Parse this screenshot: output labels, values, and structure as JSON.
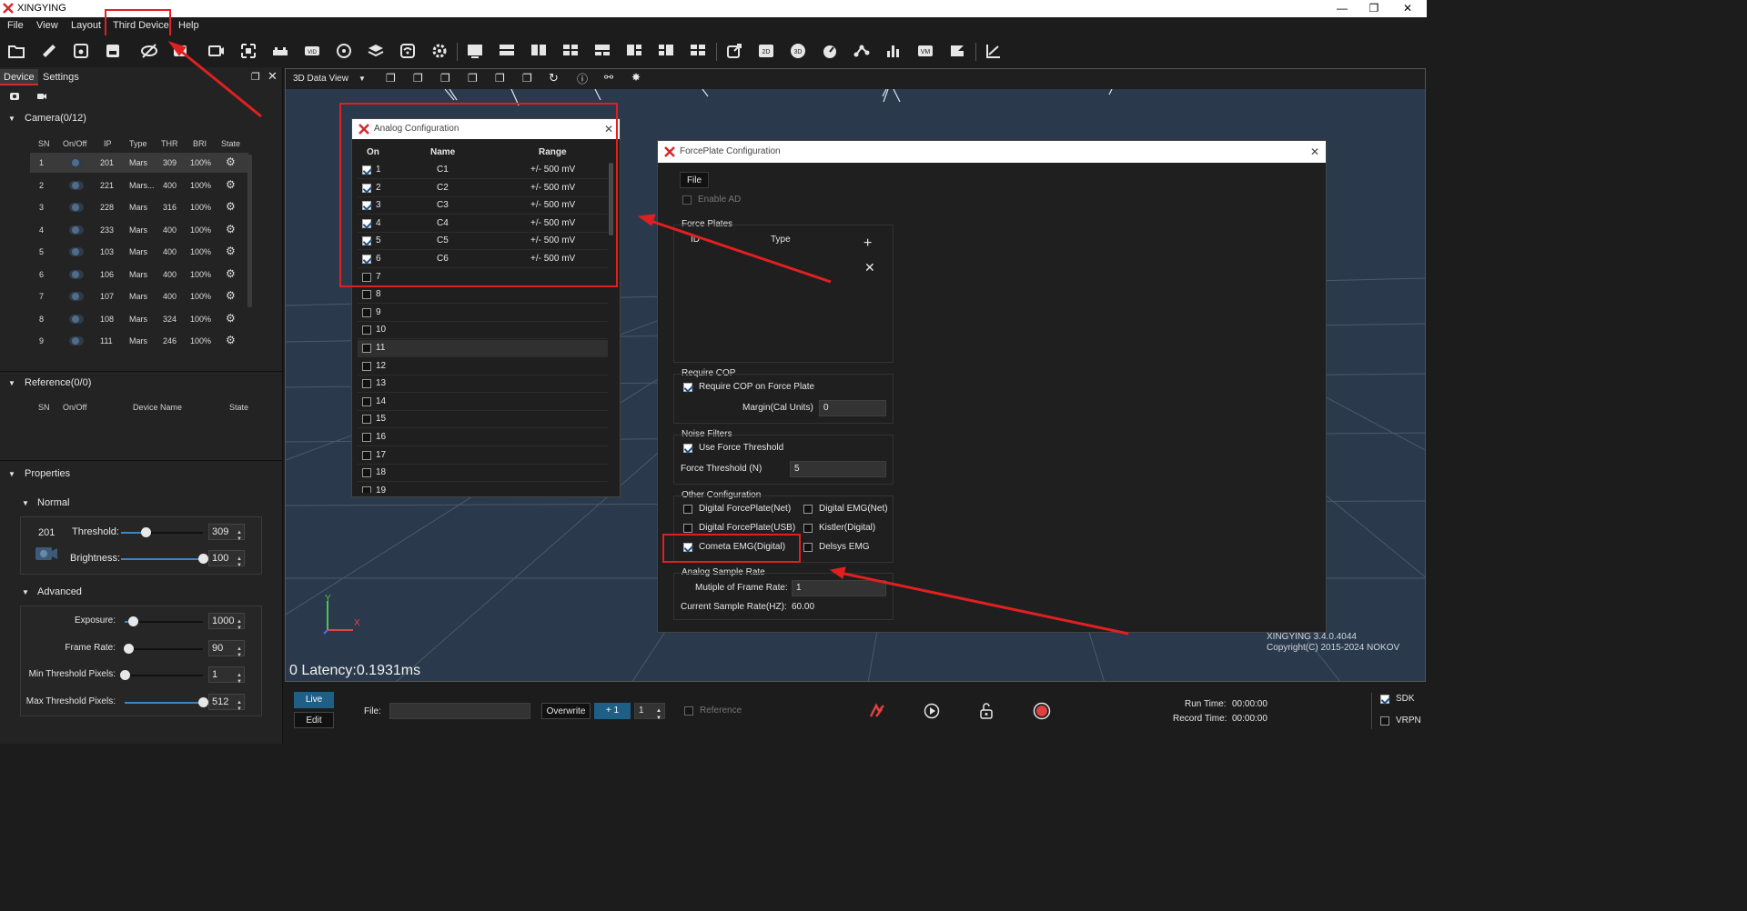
{
  "app": {
    "title": "XINGYING"
  },
  "menu": [
    "File",
    "View",
    "Layout",
    "Third Device",
    "Help"
  ],
  "left_panel": {
    "tabs": [
      "Device",
      "Settings"
    ],
    "camera": {
      "header": "Camera(0/12)",
      "columns": [
        "SN",
        "On/Off",
        "IP",
        "Type",
        "THR",
        "BRI",
        "State"
      ],
      "rows": [
        {
          "sn": "1",
          "ip": "201",
          "type": "Mars",
          "thr": "309",
          "bri": "100%"
        },
        {
          "sn": "2",
          "ip": "221",
          "type": "Mars...",
          "thr": "400",
          "bri": "100%"
        },
        {
          "sn": "3",
          "ip": "228",
          "type": "Mars",
          "thr": "316",
          "bri": "100%"
        },
        {
          "sn": "4",
          "ip": "233",
          "type": "Mars",
          "thr": "400",
          "bri": "100%"
        },
        {
          "sn": "5",
          "ip": "103",
          "type": "Mars",
          "thr": "400",
          "bri": "100%"
        },
        {
          "sn": "6",
          "ip": "106",
          "type": "Mars",
          "thr": "400",
          "bri": "100%"
        },
        {
          "sn": "7",
          "ip": "107",
          "type": "Mars",
          "thr": "400",
          "bri": "100%"
        },
        {
          "sn": "8",
          "ip": "108",
          "type": "Mars",
          "thr": "324",
          "bri": "100%"
        },
        {
          "sn": "9",
          "ip": "111",
          "type": "Mars",
          "thr": "246",
          "bri": "100%"
        }
      ]
    },
    "reference": {
      "header": "Reference(0/0)",
      "columns": [
        "SN",
        "On/Off",
        "Device Name",
        "State"
      ]
    },
    "properties": {
      "header": "Properties",
      "normal": {
        "header": "Normal",
        "camera_id": "201",
        "threshold_label": "Threshold:",
        "threshold": "309",
        "threshold_frac": 0.3,
        "brightness_label": "Brightness:",
        "brightness": "100",
        "brightness_frac": 1.0
      },
      "advanced": {
        "header": "Advanced",
        "items": [
          {
            "label": "Exposure:",
            "value": "1000",
            "frac": 0.1
          },
          {
            "label": "Frame Rate:",
            "value": "90",
            "frac": 0.05
          },
          {
            "label": "Min Threshold Pixels:",
            "value": "1",
            "frac": 0.0
          },
          {
            "label": "Max Threshold Pixels:",
            "value": "512",
            "frac": 1.0
          }
        ]
      }
    }
  },
  "viewport": {
    "view_select": "3D Data View",
    "latency": "0 Latency:0.1931ms",
    "axis_y": "Y",
    "axis_x": "X",
    "version": "XINGYING 3.4.0.4044",
    "copyright": "Copyright(C) 2015-2024 NOKOV"
  },
  "analog_dialog": {
    "title": "Analog Configuration",
    "columns": [
      "On",
      "Name",
      "Range"
    ],
    "rows": [
      {
        "num": "1",
        "checked": true,
        "name": "C1",
        "range": "+/- 500 mV"
      },
      {
        "num": "2",
        "checked": true,
        "name": "C2",
        "range": "+/- 500 mV"
      },
      {
        "num": "3",
        "checked": true,
        "name": "C3",
        "range": "+/- 500 mV"
      },
      {
        "num": "4",
        "checked": true,
        "name": "C4",
        "range": "+/- 500 mV"
      },
      {
        "num": "5",
        "checked": true,
        "name": "C5",
        "range": "+/- 500 mV"
      },
      {
        "num": "6",
        "checked": true,
        "name": "C6",
        "range": "+/- 500 mV"
      },
      {
        "num": "7",
        "checked": false,
        "name": "",
        "range": ""
      },
      {
        "num": "8",
        "checked": false,
        "name": "",
        "range": ""
      },
      {
        "num": "9",
        "checked": false,
        "name": "",
        "range": ""
      },
      {
        "num": "10",
        "checked": false,
        "name": "",
        "range": ""
      },
      {
        "num": "11",
        "checked": false,
        "name": "",
        "range": ""
      },
      {
        "num": "12",
        "checked": false,
        "name": "",
        "range": ""
      },
      {
        "num": "13",
        "checked": false,
        "name": "",
        "range": ""
      },
      {
        "num": "14",
        "checked": false,
        "name": "",
        "range": ""
      },
      {
        "num": "15",
        "checked": false,
        "name": "",
        "range": ""
      },
      {
        "num": "16",
        "checked": false,
        "name": "",
        "range": ""
      },
      {
        "num": "17",
        "checked": false,
        "name": "",
        "range": ""
      },
      {
        "num": "18",
        "checked": false,
        "name": "",
        "range": ""
      },
      {
        "num": "19",
        "checked": false,
        "name": "",
        "range": ""
      }
    ]
  },
  "forceplate_dialog": {
    "title": "ForcePlate Configuration",
    "file_btn": "File",
    "enable_ad": "Enable AD",
    "force_plates": {
      "label": "Force Plates",
      "col_id": "ID",
      "col_type": "Type"
    },
    "require_cop": {
      "label": "Require COP",
      "check": "Require COP on Force Plate",
      "margin_label": "Margin(Cal Units)",
      "margin": "0"
    },
    "noise": {
      "label": "Noise Filters",
      "check": "Use Force Threshold",
      "thr_label": "Force Threshold (N)",
      "thr": "5"
    },
    "other": {
      "label": "Other Configuration",
      "items": [
        {
          "text": "Digital ForcePlate(Net)",
          "checked": false
        },
        {
          "text": "Digital EMG(Net)",
          "checked": false
        },
        {
          "text": "Digital ForcePlate(USB)",
          "checked": false
        },
        {
          "text": "Kistler(Digital)",
          "checked": false
        },
        {
          "text": "Cometa EMG(Digital)",
          "checked": true
        },
        {
          "text": "Delsys EMG",
          "checked": false
        }
      ]
    },
    "sample": {
      "label": "Analog Sample Rate",
      "mult_label": "Mutiple of Frame Rate:",
      "mult": "1",
      "current_label": "Current Sample Rate(HZ):",
      "current": "60.00"
    }
  },
  "bottom": {
    "live": "Live",
    "edit": "Edit",
    "file_label": "File:",
    "overwrite": "Overwrite",
    "plus_one": "+ 1",
    "counter": "1",
    "reference": "Reference",
    "run_time_label": "Run Time:",
    "run_time": "00:00:00",
    "record_time_label": "Record Time:",
    "record_time": "00:00:00",
    "sdk": "SDK",
    "vrpn": "VRPN"
  },
  "colors": {
    "accent": "#3a86c8",
    "annotation": "#e02020",
    "viewport_bg": "#2a3a4c",
    "live_btn": "#1f5f86",
    "record": "#e04040"
  }
}
